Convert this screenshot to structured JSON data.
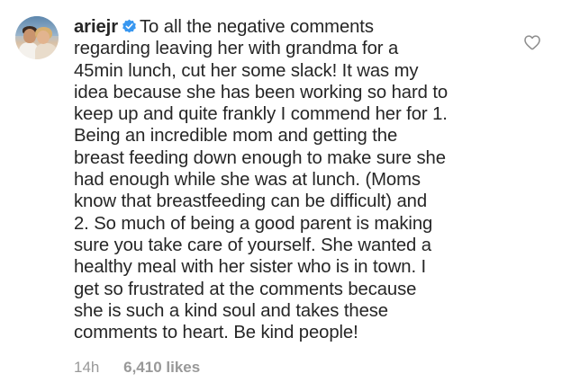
{
  "comment": {
    "username": "ariejr",
    "verified_badge_icon": "verified-badge-icon",
    "text_lines": [
      "To all the negative comments",
      "regarding leaving her with grandma for a",
      "45min lunch, cut her some slack! It was my",
      "idea because she has been working so hard to",
      "keep up and quite frankly I commend her for 1.",
      "Being an incredible mom and getting the",
      "breast feeding down enough to make sure she",
      "had enough while she was at lunch. (Moms",
      "know that breastfeeding can be difficult) and",
      "2. So much of being a good parent is making",
      "sure you take care of yourself. She wanted a",
      "healthy meal with her sister who is in town. I",
      "get so frustrated at the comments because",
      "she is such a kind soul and takes these",
      "comments to heart. Be kind people!"
    ],
    "timestamp": "14h",
    "likes": "6,410 likes",
    "like_icon": "heart-outline-icon"
  },
  "colors": {
    "text": "#262626",
    "muted": "#999999",
    "verified_blue": "#3897f0",
    "heart_outline": "#8e8e8e",
    "background": "#ffffff"
  }
}
